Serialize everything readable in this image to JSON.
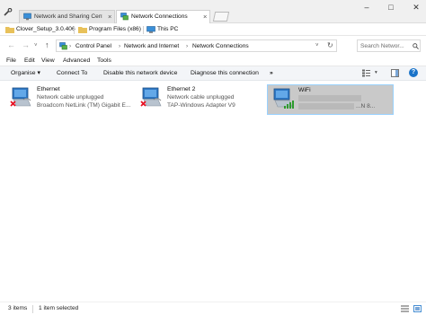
{
  "tabs": [
    {
      "label": "Network and Sharing Centre",
      "close": "×"
    },
    {
      "label": "Network Connections",
      "close": "×"
    }
  ],
  "window_controls": {
    "minimize": "–",
    "maximize": "□",
    "close": "✕"
  },
  "favourites": [
    {
      "label": "Clover_Setup_3.0.406"
    },
    {
      "label": "Program Files (x86)"
    },
    {
      "label": "This PC"
    }
  ],
  "nav": {
    "back": "←",
    "forward": "→",
    "recent": "˅",
    "up": "↑"
  },
  "address": {
    "crumbs": [
      "Control Panel",
      "Network and Internet",
      "Network Connections"
    ],
    "separator": "›",
    "dropdown": "˅",
    "refresh": "↻"
  },
  "search": {
    "placeholder": "Search Networ..."
  },
  "menu": [
    "File",
    "Edit",
    "View",
    "Advanced",
    "Tools"
  ],
  "commands": {
    "organise": "Organise ▾",
    "connect": "Connect To",
    "disable": "Disable this network device",
    "diagnose": "Diagnose this connection",
    "more": "»",
    "view_dropdown": "▾",
    "help": "?"
  },
  "connections": [
    {
      "name": "Ethernet",
      "status": "Network cable unplugged",
      "device": "Broadcom NetLink (TM) Gigabit E...",
      "icon": "ethernet-disconnected-icon"
    },
    {
      "name": "Ethernet 2",
      "status": "Network cable unplugged",
      "device": "TAP-Windows Adapter V9",
      "icon": "ethernet-disconnected-icon"
    },
    {
      "name": "WiFi",
      "status": "",
      "device": "...N 8...",
      "icon": "wifi-connected-icon"
    }
  ],
  "status": {
    "items": "3 items",
    "selected": "1 item selected"
  },
  "colors": {
    "selection": "#cde8ff",
    "accent": "#1a73c9",
    "error": "#e81123"
  }
}
